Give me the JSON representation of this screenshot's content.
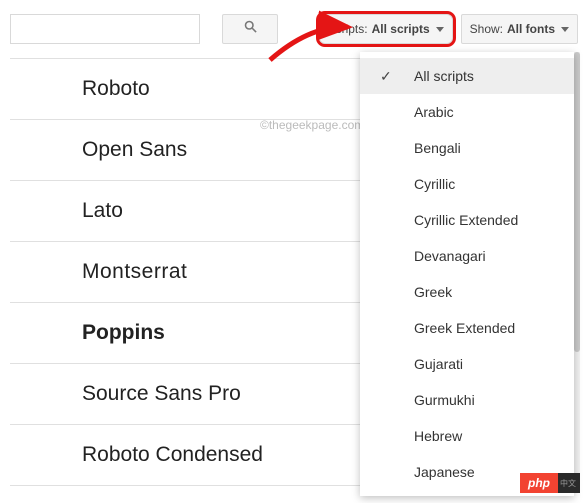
{
  "toolbar": {
    "search_placeholder": "",
    "scripts_prefix": "Scripts: ",
    "scripts_value": "All scripts",
    "show_prefix": "Show: ",
    "show_value": "All fonts"
  },
  "fonts": [
    {
      "name": "Roboto",
      "css": "font-family: Arial, sans-serif; font-weight:400;"
    },
    {
      "name": "Open Sans",
      "css": "font-family: 'Segoe UI', Arial, sans-serif; font-weight:400;"
    },
    {
      "name": "Lato",
      "css": "font-family: Arial, sans-serif; font-weight:400;"
    },
    {
      "name": "Montserrat",
      "css": "font-family: 'Trebuchet MS', Arial, sans-serif; font-weight:400; letter-spacing:0.5px;"
    },
    {
      "name": "Poppins",
      "css": "font-family: Arial, sans-serif; font-weight:600;"
    },
    {
      "name": "Source Sans Pro",
      "css": "font-family: Arial, sans-serif; font-weight:400;"
    },
    {
      "name": "Roboto Condensed",
      "css": "font-family: 'Arial Narrow', Arial, sans-serif; font-weight:400;"
    }
  ],
  "scripts_menu": {
    "selected_index": 0,
    "items": [
      "All scripts",
      "Arabic",
      "Bengali",
      "Cyrillic",
      "Cyrillic Extended",
      "Devanagari",
      "Greek",
      "Greek Extended",
      "Gujarati",
      "Gurmukhi",
      "Hebrew",
      "Japanese"
    ]
  },
  "watermark": "©thegeekpage.com",
  "badge": "php"
}
